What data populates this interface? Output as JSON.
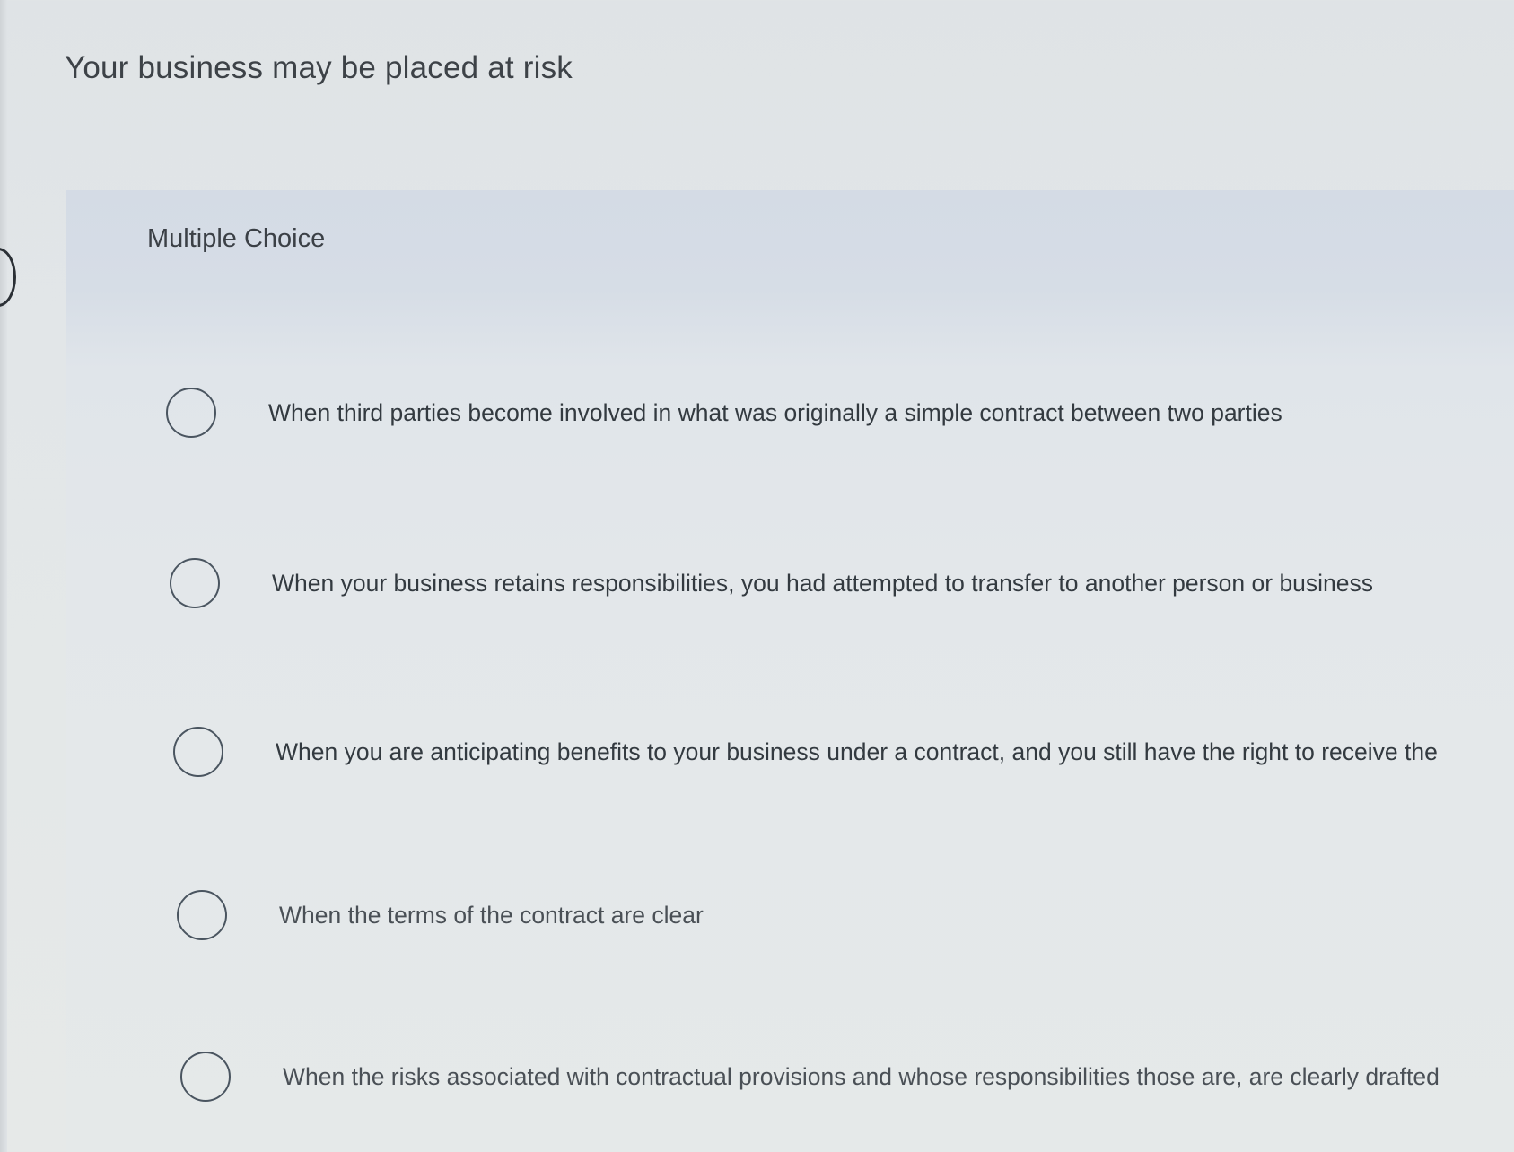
{
  "question": {
    "text": "Your business may be placed at risk"
  },
  "question_type": {
    "label": "Multiple Choice"
  },
  "options": [
    {
      "text": "When third parties become involved in what was originally a simple contract between two parties",
      "selected": false
    },
    {
      "text": "When your business retains responsibilities, you had attempted to transfer to another person or business",
      "selected": false
    },
    {
      "text": "When you are anticipating benefits to your business under a contract, and you still have the right to receive the",
      "selected": false
    },
    {
      "text": "When the terms of the contract are clear",
      "selected": false
    },
    {
      "text": "When the risks associated with contractual provisions and whose responsibilities those are, are clearly drafted",
      "selected": false
    }
  ]
}
